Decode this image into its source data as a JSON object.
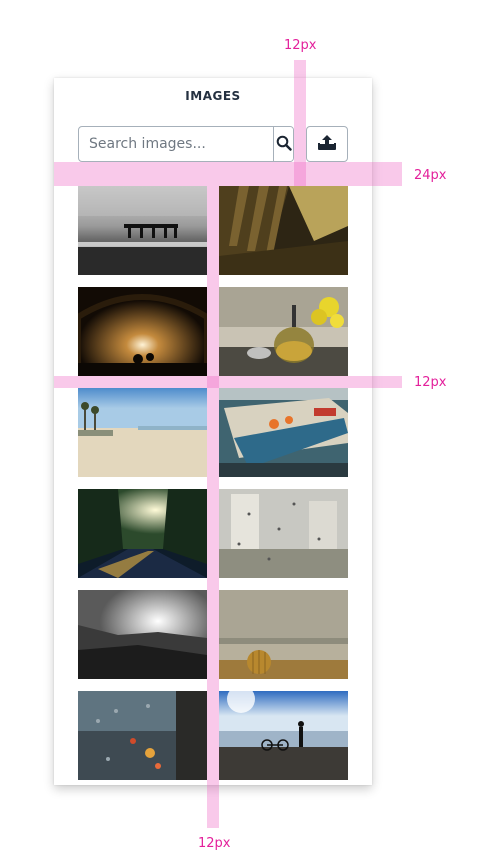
{
  "panel": {
    "title": "IMAGES"
  },
  "search": {
    "placeholder": "Search images..."
  },
  "icons": {
    "search": "search-icon",
    "upload": "upload-icon"
  },
  "colors": {
    "annotation": "#e3209b",
    "title": "#243040",
    "border": "#a6b0ba"
  },
  "annotations": {
    "top_gap": "12px",
    "search_gap": "24px",
    "row_gap": "12px",
    "column_gap": "12px"
  }
}
